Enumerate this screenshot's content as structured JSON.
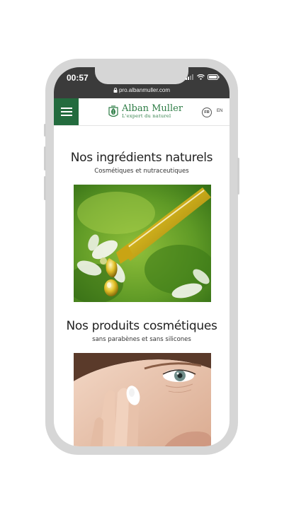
{
  "status": {
    "time": "00:57",
    "url": "pro.albanmuller.com"
  },
  "brand": {
    "name": "Alban Muller",
    "tagline": "L'expert du naturel"
  },
  "languages": {
    "fr": "FR",
    "en": "EN"
  },
  "sections": [
    {
      "title": "Nos ingrédients naturels",
      "subtitle": "Cosmétiques et nutraceutiques"
    },
    {
      "title": "Nos produits cosmétiques",
      "subtitle": "sans parabènes et sans silicones"
    }
  ],
  "colors": {
    "brand_green": "#236b3e",
    "statusbar": "#3b3b3b",
    "phone_frame": "#d6d6d6"
  }
}
